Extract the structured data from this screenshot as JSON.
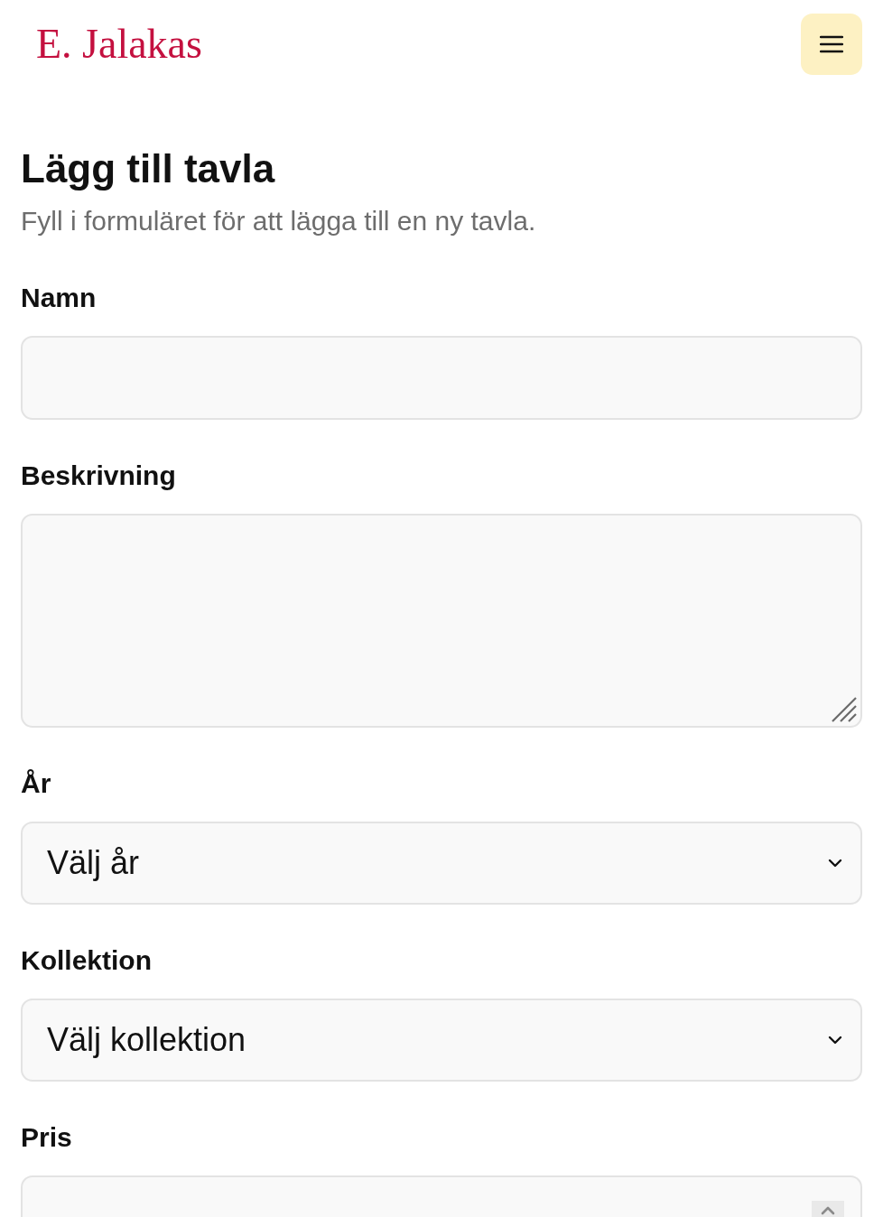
{
  "header": {
    "logo": "E. Jalakas"
  },
  "page": {
    "title": "Lägg till tavla",
    "subtitle": "Fyll i formuläret för att lägga till en ny tavla."
  },
  "form": {
    "fields": [
      {
        "kind": "text",
        "label": "Namn"
      },
      {
        "kind": "textarea",
        "label": "Beskrivning"
      },
      {
        "kind": "select",
        "label": "År",
        "value": "Välj år"
      },
      {
        "kind": "select",
        "label": "Kollektion",
        "value": "Välj kollektion"
      },
      {
        "kind": "number",
        "label": "Pris"
      }
    ]
  }
}
